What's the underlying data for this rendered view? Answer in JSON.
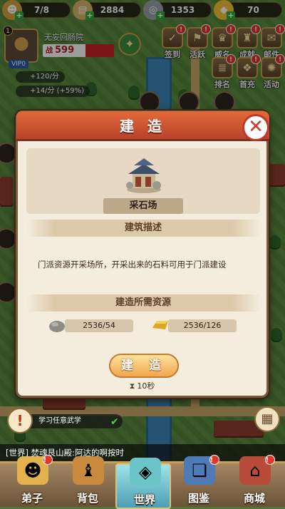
{
  "resources": [
    {
      "name": "disciples",
      "icon": "disciple-icon",
      "value": "7/8",
      "color": "#d9a441"
    },
    {
      "name": "scroll",
      "icon": "scroll-icon",
      "value": "2884",
      "color": "#d9b56a"
    },
    {
      "name": "coin",
      "icon": "coin-icon",
      "value": "1353",
      "color": "#9aa2a8"
    },
    {
      "name": "gold",
      "icon": "gold-ingot-icon",
      "value": "70",
      "color": "#f2c337"
    }
  ],
  "profile": {
    "level_badge": "1",
    "name": "无妄回肠院",
    "power_tag": "战",
    "power": "599",
    "vip": "VIP0"
  },
  "rates": [
    "+120/分",
    "+14/分 (+59%)"
  ],
  "top_icons": [
    {
      "label": "签到",
      "badge": "!"
    },
    {
      "label": "活跃",
      "badge": "!"
    },
    {
      "label": "威名",
      "badge": "!"
    },
    {
      "label": "成就",
      "badge": "!"
    },
    {
      "label": "邮件",
      "badge": "!"
    },
    {
      "label": "排名",
      "badge": "!"
    },
    {
      "label": "首充",
      "badge": "!"
    },
    {
      "label": "活动",
      "badge": "!"
    }
  ],
  "dialog": {
    "title": "建 造",
    "building_name": "采石场",
    "desc_header": "建筑描述",
    "description": "门派资源开采场所，开采出来的石料可用于门派建设",
    "req_header": "建造所需资源",
    "requirements": [
      {
        "icon": "stone-icon",
        "amount": "2536/54"
      },
      {
        "icon": "gold-bar-icon",
        "amount": "2536/126"
      }
    ],
    "build_button": "建 造",
    "time": "10秒"
  },
  "quest": {
    "text": "学习任意武学"
  },
  "chat": {
    "text": "[世界] 焚魂艮山殿:阿达的啊按时"
  },
  "bottom_nav": [
    {
      "label": "弟子",
      "badge": "!"
    },
    {
      "label": "背包",
      "badge": ""
    },
    {
      "label": "世界",
      "badge": "",
      "active": true
    },
    {
      "label": "图鉴",
      "badge": "!"
    },
    {
      "label": "商城",
      "badge": "!"
    }
  ]
}
